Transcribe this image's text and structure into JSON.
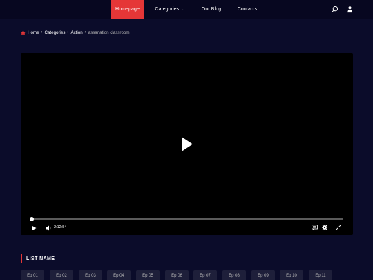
{
  "header": {
    "nav": [
      {
        "label": "Homepage"
      },
      {
        "label": "Categories"
      },
      {
        "label": "Our Blog"
      },
      {
        "label": "Contacts"
      }
    ],
    "icons": {
      "search": "search-icon",
      "user": "user-icon"
    },
    "accent": "#e53637"
  },
  "breadcrumb": {
    "items": [
      "Home",
      "Categories",
      "Action"
    ],
    "current": "assanation classroom"
  },
  "player": {
    "time": "2:12:54",
    "progress": 0.0
  },
  "list": {
    "title": "LIST NAME",
    "episodes": [
      "Ep 01",
      "Ep 02",
      "Ep 03",
      "Ep 04",
      "Ep 05",
      "Ep 06",
      "Ep 07",
      "Ep 08",
      "Ep 09",
      "Ep 10",
      "Ep 11"
    ]
  }
}
